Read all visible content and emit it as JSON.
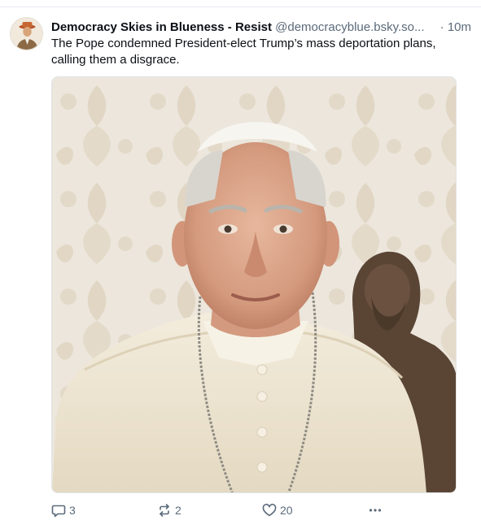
{
  "post": {
    "author": {
      "display_name": "Democracy Skies in Blueness - Resist",
      "handle": "@democracyblue.bsky.so...",
      "time_separator": "·",
      "timestamp": "10m"
    },
    "text_line1": "The Pope condemned President-elect Trump’s mass deportation plans,",
    "text_line2": "calling them a disgrace.",
    "actions": {
      "reply_count": "3",
      "repost_count": "2",
      "like_count": "20"
    }
  },
  "colors": {
    "text": "#0b0f14",
    "muted": "#5b6a7a",
    "divider": "#e6eaee"
  },
  "icons": [
    "reply-icon",
    "repost-icon",
    "heart-icon",
    "more-icon"
  ]
}
